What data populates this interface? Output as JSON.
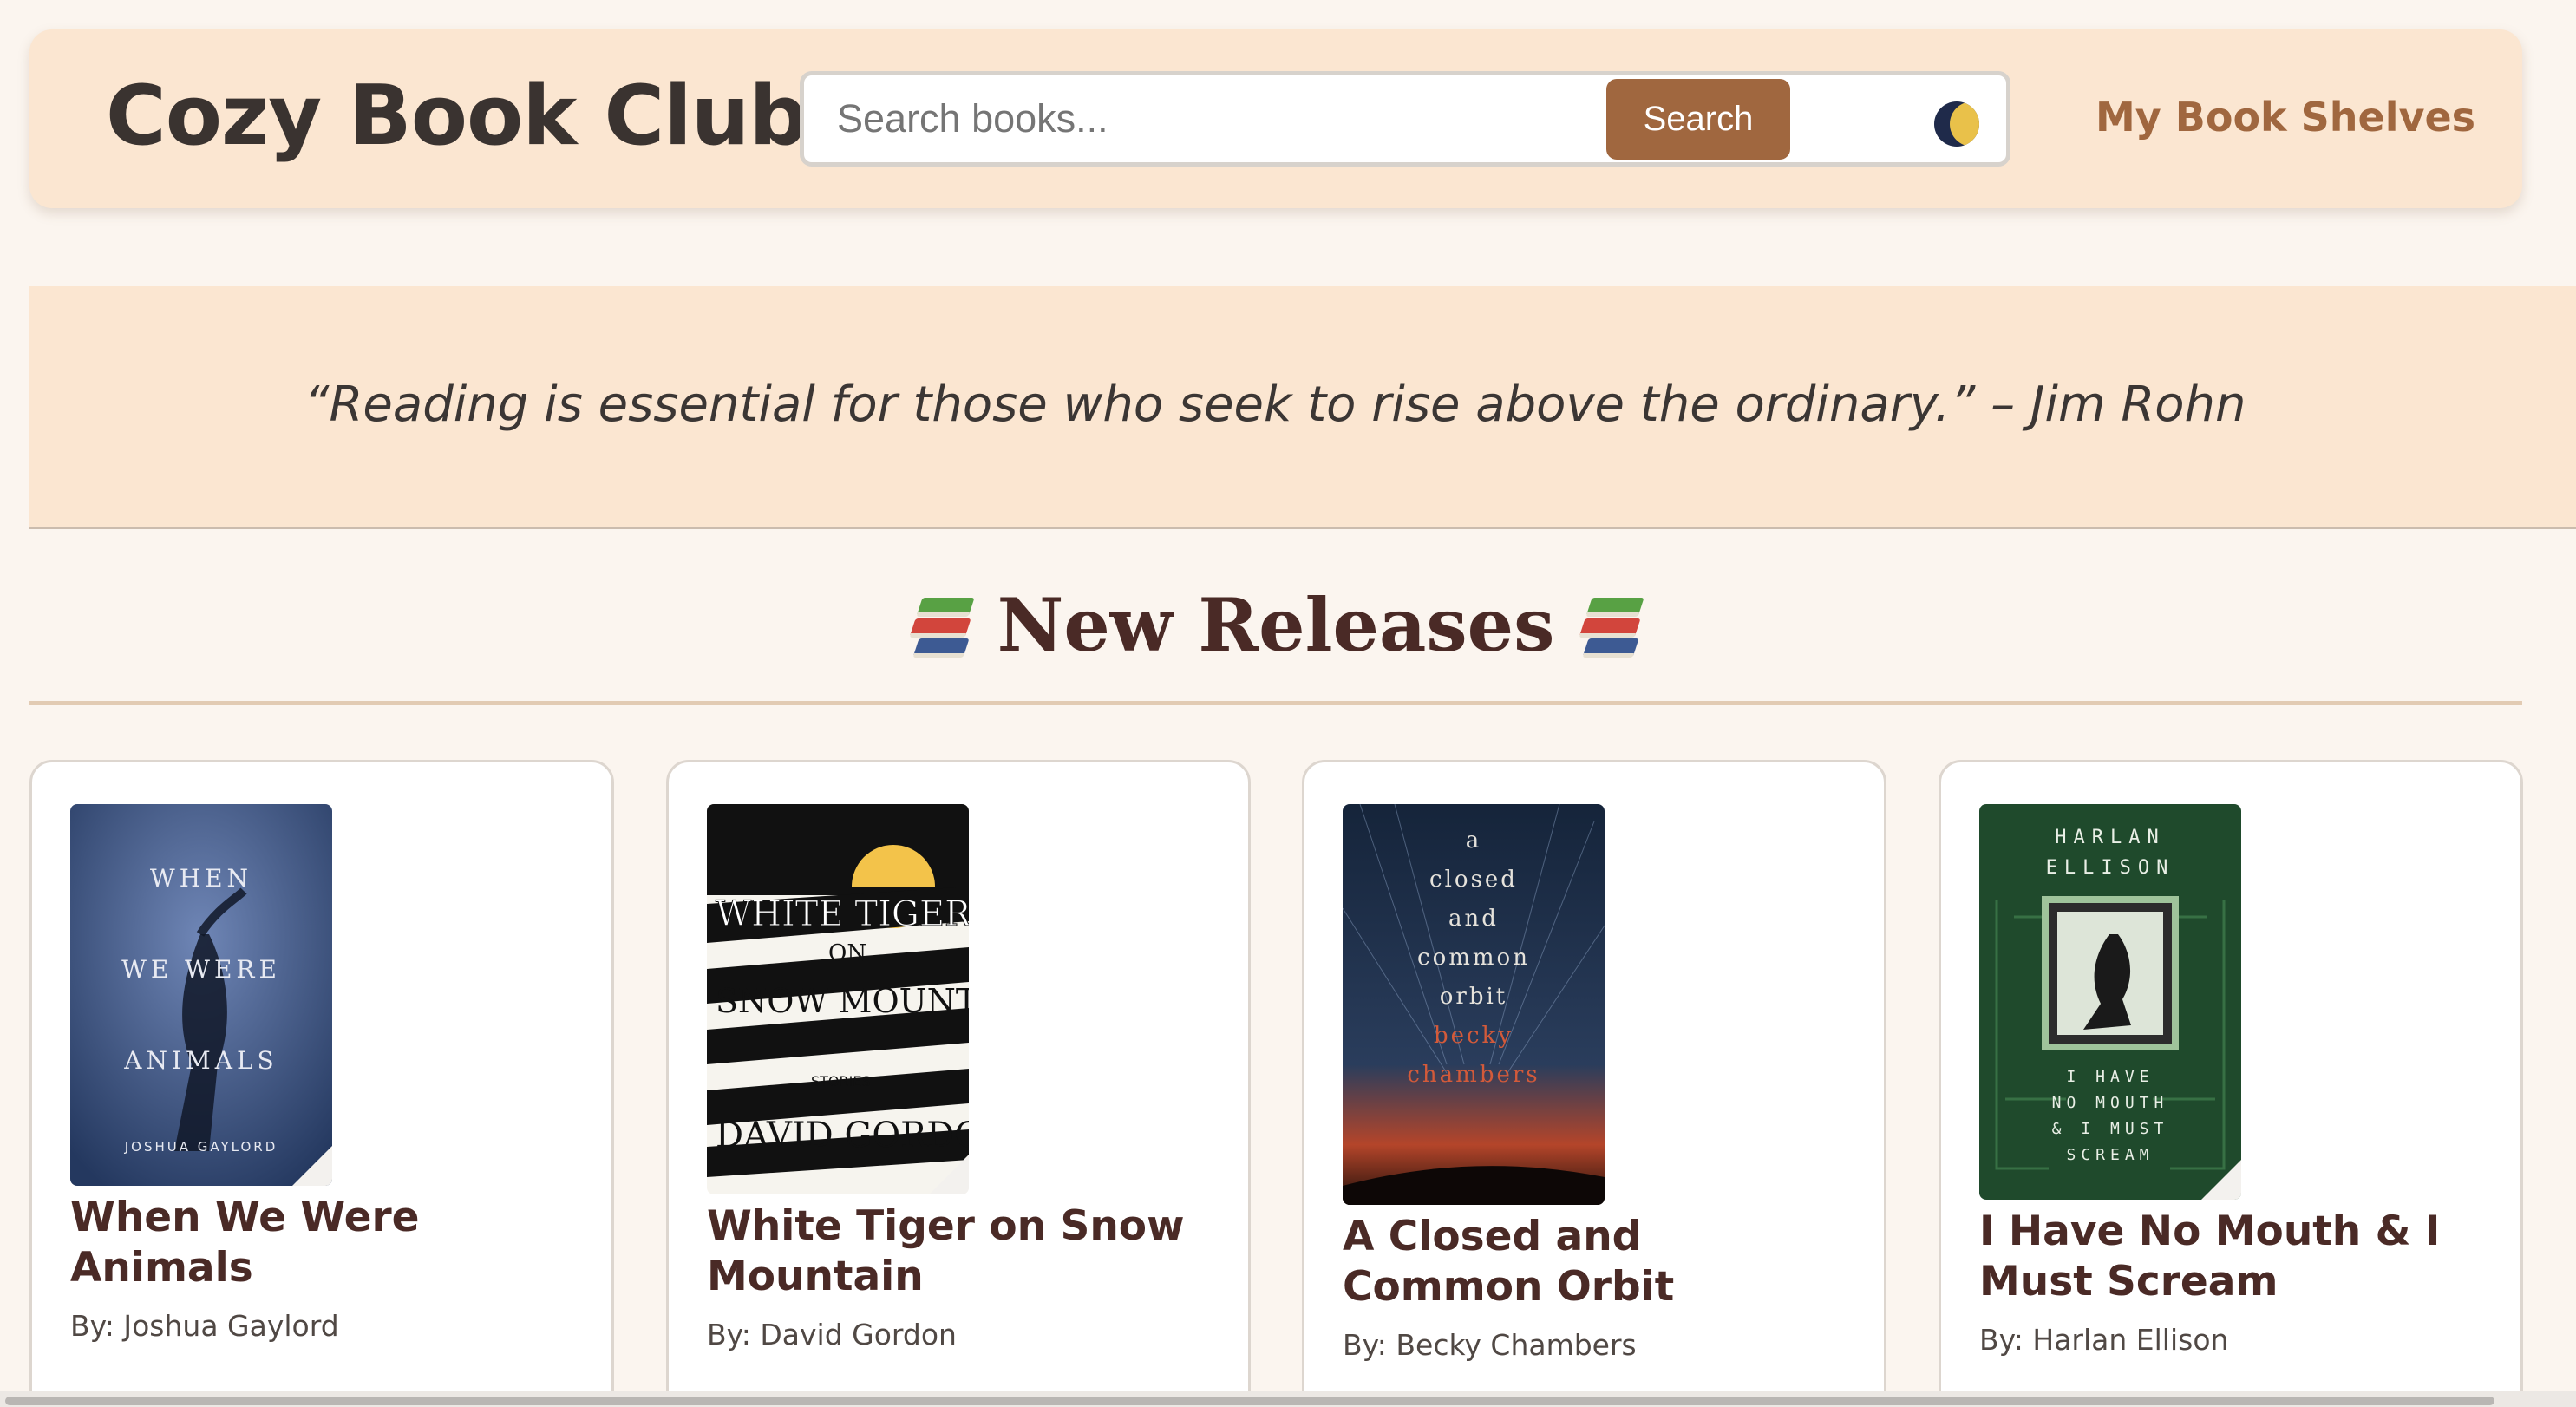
{
  "header": {
    "site_title": "Cozy Book Club",
    "search_placeholder": "Search books...",
    "search_button_label": "Search",
    "theme_icon": "moon-icon",
    "shelves_link_label": "My Book Shelves"
  },
  "quote": {
    "text": "“Reading is essential for those who seek to rise above the ordinary.” – Jim Rohn"
  },
  "section": {
    "title": "New Releases",
    "icon": "books-icon"
  },
  "books": [
    {
      "title": "When We Were Animals",
      "author": "By: Joshua Gaylord",
      "cover": {
        "l1": "WHEN",
        "l2": "WE WERE",
        "l3": "ANIMALS",
        "l4": "JOSHUA GAYLORD"
      }
    },
    {
      "title": "White Tiger on Snow Mountain",
      "author": "By: David Gordon",
      "cover": {
        "l1": "WHITE TIGER",
        "l2": "ON",
        "l3": "SNOW MOUNTAIN",
        "l4": "STORIES",
        "l5": "DAVID GORDON"
      }
    },
    {
      "title": "A Closed and Common Orbit",
      "author": "By: Becky Chambers",
      "cover": {
        "l1": "a",
        "l2": "closed",
        "l3": "and",
        "l4": "common",
        "l5": "orbit",
        "l6": "becky",
        "l7": "chambers"
      }
    },
    {
      "title": "I Have No Mouth & I Must Scream",
      "author": "By: Harlan Ellison",
      "cover": {
        "l1": "HARLAN",
        "l2": "ELLISON",
        "l3": "I HAVE",
        "l4": "NO MOUTH",
        "l5": "& I MUST",
        "l6": "SCREAM"
      }
    }
  ],
  "colors": {
    "page_bg": "#fbf5ef",
    "header_bg": "#fbe6d1",
    "accent": "#a0673f",
    "heading": "#4a2a26"
  }
}
